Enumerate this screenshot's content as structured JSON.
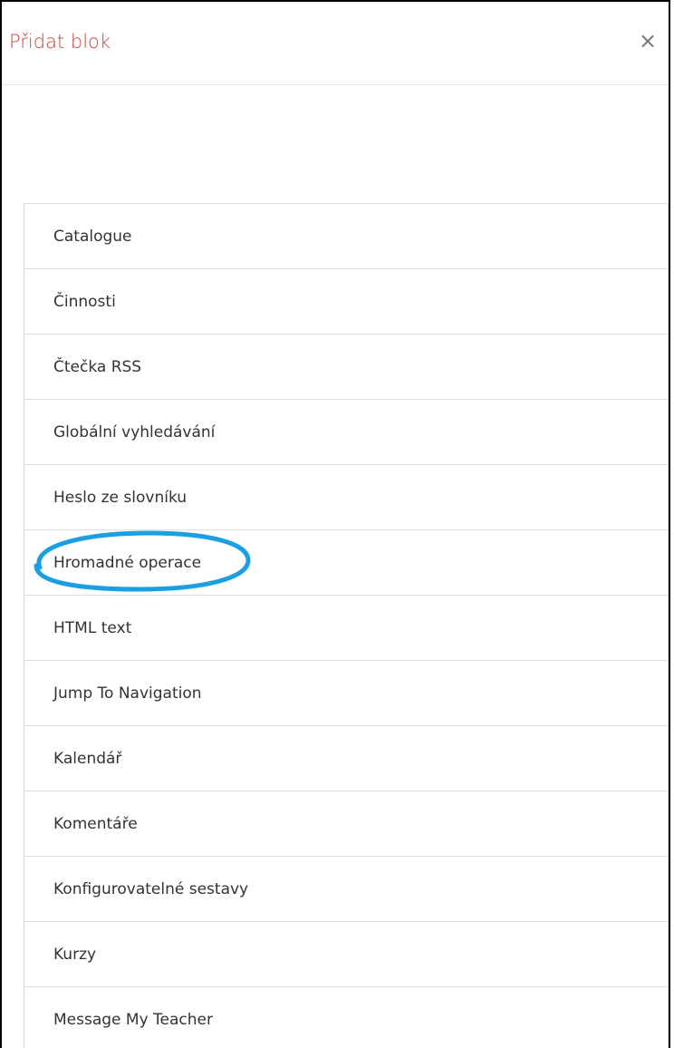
{
  "dialog": {
    "title": "Přidat blok",
    "close_symbol": "×"
  },
  "blocks": [
    {
      "label": "Catalogue"
    },
    {
      "label": "Činnosti"
    },
    {
      "label": "Čtečka RSS"
    },
    {
      "label": "Globální vyhledávání"
    },
    {
      "label": "Heslo ze slovníku"
    },
    {
      "label": "Hromadné operace"
    },
    {
      "label": "HTML text"
    },
    {
      "label": "Jump To Navigation"
    },
    {
      "label": "Kalendář"
    },
    {
      "label": "Komentáře"
    },
    {
      "label": "Konfigurovatelné sestavy"
    },
    {
      "label": "Kurzy"
    },
    {
      "label": "Message My Teacher"
    }
  ],
  "colors": {
    "title": "#c9413a",
    "highlight": "#1aa0e0",
    "border": "#dddddd",
    "text": "#333333"
  }
}
